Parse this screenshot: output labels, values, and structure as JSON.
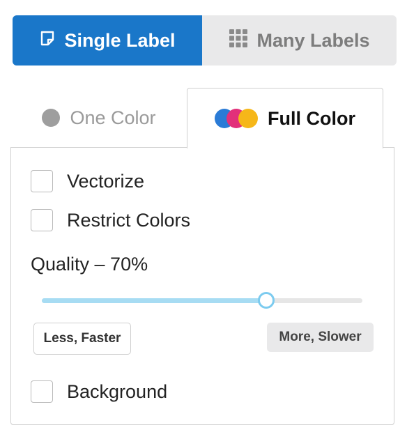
{
  "mode_toggle": {
    "single_label": "Single Label",
    "many_labels": "Many Labels",
    "selected": "single"
  },
  "color_tabs": {
    "one_color": "One Color",
    "full_color": "Full Color",
    "selected": "full"
  },
  "options": {
    "vectorize": {
      "label": "Vectorize",
      "checked": false
    },
    "restrict_colors": {
      "label": "Restrict Colors",
      "checked": false
    },
    "background": {
      "label": "Background",
      "checked": false
    }
  },
  "quality": {
    "label": "Quality – 70%",
    "value": 0.7,
    "less_label": "Less, Faster",
    "more_label": "More, Slower"
  },
  "colors": {
    "accent": "#1a77c9",
    "slider_fill": "#a7dcf3",
    "dot_blue": "#2a7bd6",
    "dot_pink": "#e2307a",
    "dot_yellow": "#f6b719"
  }
}
